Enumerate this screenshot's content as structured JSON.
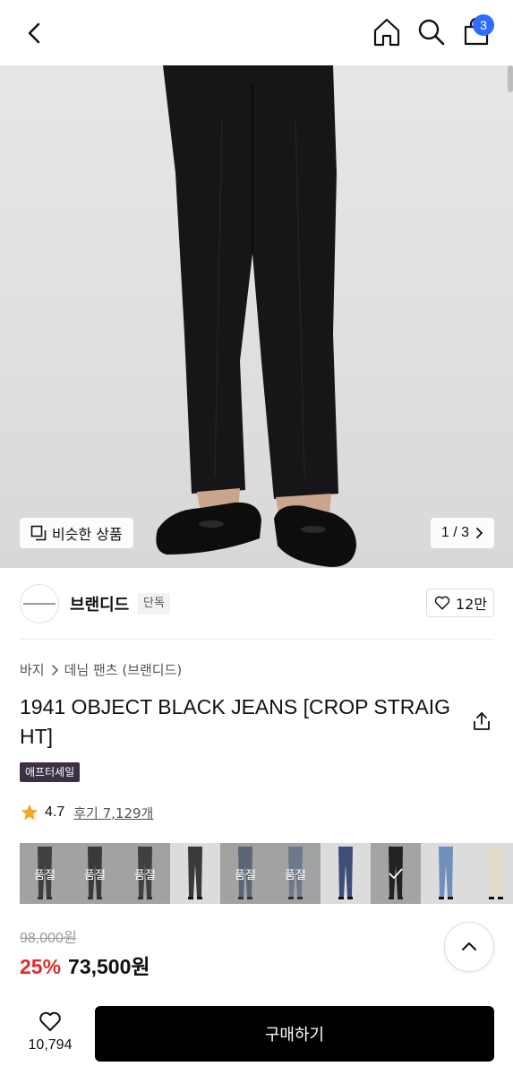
{
  "header": {
    "cart_count": "3",
    "icons": [
      "back-icon",
      "home-icon",
      "search-icon",
      "shopping-bag-icon"
    ]
  },
  "gallery": {
    "similar_label": "비슷한 상품",
    "pager": "1 / 3"
  },
  "brand": {
    "name": "브랜디드",
    "tag": "단독",
    "likes": "12만"
  },
  "breadcrumb": {
    "category": "바지",
    "subcategory": "데님 팬츠 (브랜디드)"
  },
  "product": {
    "title": "1941 OBJECT BLACK JEANS [CROP STRAIGHT]",
    "badge": "애프터세일",
    "rating": "4.7",
    "reviews": "후기 7,129개"
  },
  "thumbnails": [
    {
      "label": "품절",
      "color": "#2a2a2a"
    },
    {
      "label": "품절",
      "color": "#1f1f1f"
    },
    {
      "label": "품절",
      "color": "#2b2b2b"
    },
    {
      "label": "",
      "color": "#3a3a3a"
    },
    {
      "label": "품절",
      "color": "#5a6e8a"
    },
    {
      "label": "품절",
      "color": "#7b93b3"
    },
    {
      "label": "",
      "color": "#3d4f78"
    },
    {
      "label": "✓",
      "color": "#151515"
    },
    {
      "label": "",
      "color": "#6f8fbd"
    },
    {
      "label": "",
      "color": "#e4ddc6"
    }
  ],
  "pricing": {
    "original": "98,000원",
    "discount": "25%",
    "price": "73,500원"
  },
  "bottom_bar": {
    "wish_count": "10,794",
    "buy_label": "구매하기"
  },
  "colors": {
    "accent_blue": "#2f6bff",
    "discount_red": "#e02b2b",
    "badge_purple": "#3b3045"
  }
}
